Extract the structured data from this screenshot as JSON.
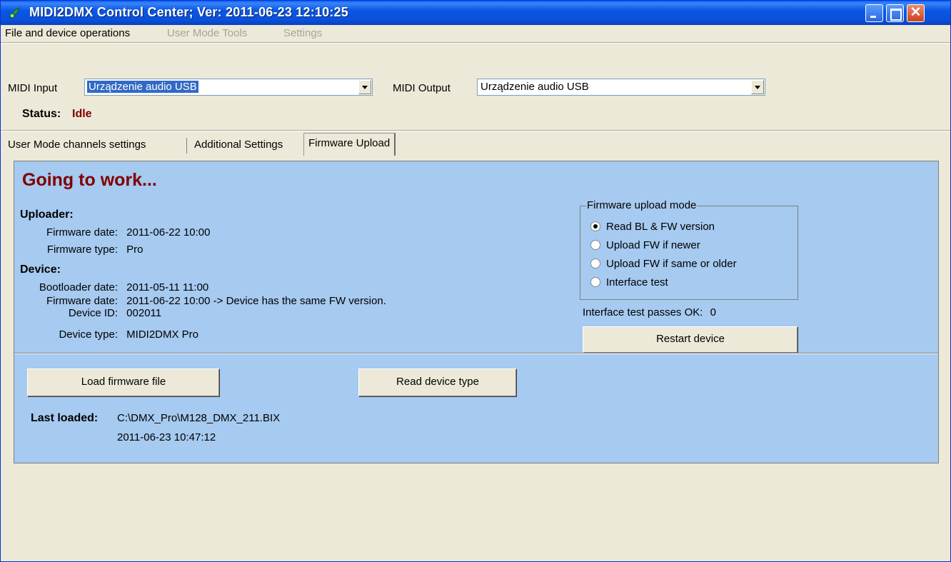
{
  "window": {
    "title": "MIDI2DMX Control Center; Ver: 2011-06-23 12:10:25",
    "close_glyph": "✕"
  },
  "menu": {
    "file": "File and device operations",
    "user_mode_tools": "User Mode Tools",
    "settings": "Settings"
  },
  "midi": {
    "input_label": "MIDI Input",
    "input_value": "Urządzenie audio USB",
    "output_label": "MIDI Output",
    "output_value": "Urządzenie audio USB"
  },
  "status": {
    "label": "Status:",
    "value": "Idle",
    "value_color": "#800000"
  },
  "tabs": [
    {
      "label": "User Mode channels settings",
      "active": false
    },
    {
      "label": "Additional Settings",
      "active": false
    },
    {
      "label": "Firmware Upload",
      "active": true
    }
  ],
  "panel": {
    "background": "#a6caf0",
    "heading": "Going to work...",
    "uploader": {
      "title": "Uploader:",
      "firmware_date_label": "Firmware date:",
      "firmware_date": "2011-06-22 10:00",
      "firmware_type_label": "Firmware type:",
      "firmware_type": "Pro"
    },
    "device": {
      "title": "Device:",
      "bootloader_date_label": "Bootloader date:",
      "bootloader_date": "2011-05-11 11:00",
      "firmware_date_label": "Firmware date:",
      "firmware_date": "2011-06-22 10:00 -> Device has the same FW version.",
      "device_id_label": "Device ID:",
      "device_id": "002011",
      "device_type_label": "Device type:",
      "device_type": "MIDI2DMX Pro"
    },
    "upload_mode": {
      "title": "Firmware upload mode",
      "options": [
        {
          "label": "Read BL & FW version",
          "checked": true
        },
        {
          "label": "Upload FW if newer",
          "checked": false
        },
        {
          "label": "Upload FW if same or older",
          "checked": false
        },
        {
          "label": "Interface test",
          "checked": false
        }
      ]
    },
    "interface_test_label": "Interface test passes OK:",
    "interface_test_value": "0",
    "restart_button": "Restart device",
    "load_button": "Load firmware file",
    "read_type_button": "Read device type",
    "last_loaded_label": "Last loaded:",
    "last_loaded_path": "C:\\DMX_Pro\\M128_DMX_211.BIX",
    "last_loaded_time": "2011-06-23 10:47:12"
  }
}
